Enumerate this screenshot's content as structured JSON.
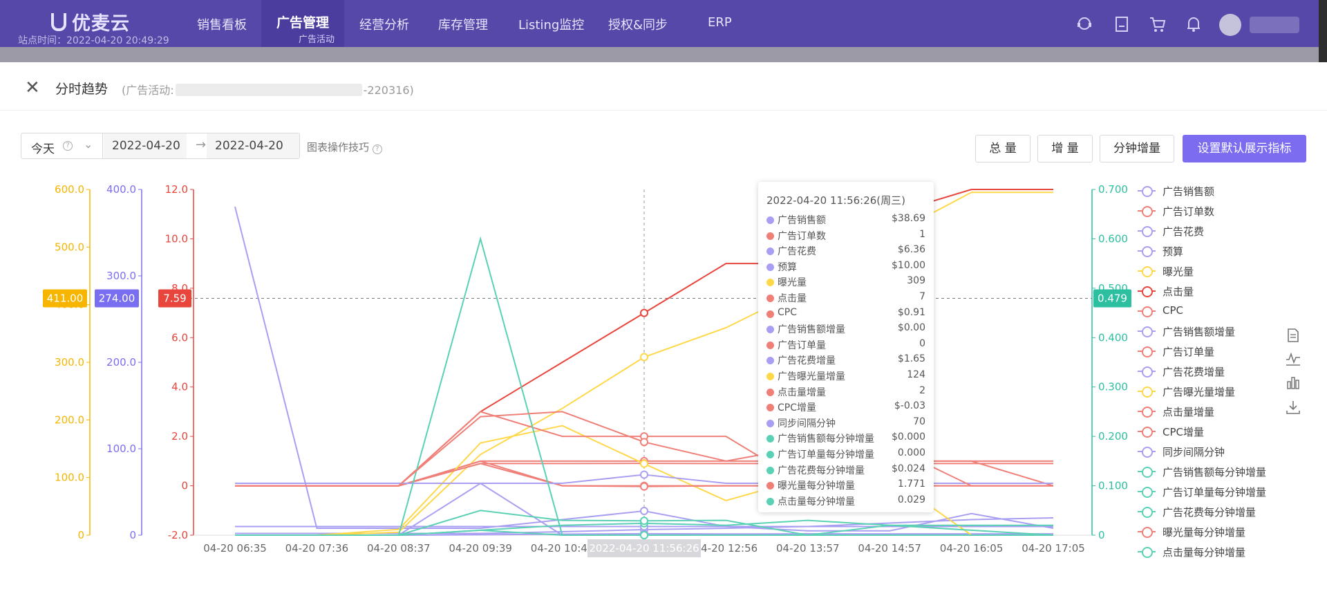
{
  "brand": "优麦云",
  "site_time": "站点时间：2022-04-20 20:49:29",
  "nav": [
    {
      "label": "销售看板"
    },
    {
      "label": "广告管理",
      "sub": "广告活动"
    },
    {
      "label": "经营分析"
    },
    {
      "label": "库存管理"
    },
    {
      "label": "Listing监控"
    },
    {
      "label": "授权&同步"
    },
    {
      "label": "ERP"
    }
  ],
  "top_icons": [
    "support-icon",
    "book-icon",
    "cart-icon",
    "bell-icon",
    "user-avatar-icon"
  ],
  "panel": {
    "title": "分时趋势",
    "subtitle_prefix": "(广告活动:",
    "subtitle_suffix": "-220316)"
  },
  "filters": {
    "range_label": "今天",
    "start_date": "2022-04-20",
    "end_date": "2022-04-20",
    "tips": "图表操作技巧"
  },
  "buttons": {
    "total": "总 量",
    "increment": "增 量",
    "minute_increment": "分钟增量",
    "set_default": "设置默认展示指标"
  },
  "colors": {
    "nav_bg": "#5548a8",
    "orange_axis": "#f7b500",
    "purple_axis": "#7a6ef0",
    "red_axis": "#e8453c",
    "teal_axis": "#2cbfa0"
  },
  "chart_data": {
    "type": "line",
    "x": [
      "04-20 06:35",
      "04-20 07:36",
      "04-20 08:37",
      "04-20 09:39",
      "04-20 10:46",
      "04-20 11:56:26",
      "04-20 12:56",
      "04-20 13:57",
      "04-20 14:57",
      "04-20 16:05",
      "04-20 17:05"
    ],
    "x_highlight": "2022-04-20 11:56:26",
    "axes": {
      "orange": {
        "min": 0,
        "max": 600,
        "ticks": [
          "0",
          "100.0",
          "200.0",
          "300.0",
          "400.0",
          "500.0",
          "600.0"
        ],
        "pointer": "411.00"
      },
      "purple": {
        "min": 0,
        "max": 400,
        "ticks": [
          "0",
          "100.0",
          "200.0",
          "300.0",
          "400.0"
        ],
        "pointer": "274.00"
      },
      "red": {
        "min": -2,
        "max": 12,
        "ticks": [
          "-2.0",
          "0",
          "2.0",
          "4.0",
          "6.0",
          "8.0",
          "10.0",
          "12.0"
        ],
        "pointer": "7.59"
      },
      "teal": {
        "min": 0,
        "max": 0.7,
        "ticks": [
          "0",
          "0.100",
          "0.200",
          "0.300",
          "0.400",
          "0.500",
          "0.600",
          "0.700"
        ],
        "pointer": "0.479"
      }
    },
    "series": [
      {
        "name": "广告销售额",
        "axis": "purple",
        "color": "#a89ff2",
        "values": [
          380,
          8,
          8,
          8,
          18,
          28,
          10,
          5,
          5,
          25,
          8
        ]
      },
      {
        "name": "广告订单数",
        "axis": "red",
        "color": "#f07f78",
        "values": [
          0,
          0,
          0,
          1,
          1,
          1,
          1,
          1,
          1,
          1,
          1
        ]
      },
      {
        "name": "广告花费",
        "axis": "purple",
        "color": "#a89ff2",
        "values": [
          2,
          2,
          2,
          2,
          4,
          6.36,
          8,
          10,
          14,
          18,
          20
        ]
      },
      {
        "name": "预算",
        "axis": "purple",
        "color": "#a89ff2",
        "values": [
          10,
          10,
          10,
          10,
          10,
          10,
          10,
          10,
          10,
          10,
          10
        ]
      },
      {
        "name": "曝光量",
        "axis": "orange",
        "color": "#ffd84a",
        "values": [
          0,
          0,
          5,
          140,
          220,
          309,
          360,
          430,
          520,
          595,
          595
        ]
      },
      {
        "name": "点击量",
        "axis": "red",
        "color": "#e8453c",
        "values": [
          0,
          0,
          0,
          3,
          5,
          7,
          9,
          9,
          11,
          12,
          12
        ]
      },
      {
        "name": "CPC",
        "axis": "red",
        "color": "#f07f78",
        "values": [
          0,
          0,
          0,
          0.9,
          0.9,
          0.91,
          0.9,
          0.9,
          0.9,
          0.9,
          0.9
        ]
      },
      {
        "name": "广告销售额增量",
        "axis": "purple",
        "color": "#a89ff2",
        "values": [
          0,
          0,
          0,
          60,
          0,
          0,
          0,
          0,
          0,
          0,
          0
        ]
      },
      {
        "name": "广告订单量",
        "axis": "red",
        "color": "#f07f78",
        "values": [
          0,
          0,
          0,
          1,
          0,
          0,
          0,
          0,
          0,
          0,
          0
        ]
      },
      {
        "name": "广告花费增量",
        "axis": "purple",
        "color": "#a89ff2",
        "values": [
          0,
          0,
          0,
          0.5,
          1.2,
          1.65,
          1.4,
          1.6,
          1.5,
          1.5,
          1.5
        ]
      },
      {
        "name": "广告曝光量增量",
        "axis": "orange",
        "color": "#ffd84a",
        "values": [
          0,
          0,
          10,
          160,
          190,
          124,
          60,
          100,
          100,
          0,
          0
        ]
      },
      {
        "name": "点击量增量",
        "axis": "red",
        "color": "#f07f78",
        "values": [
          0,
          0,
          0,
          3,
          2,
          2,
          2,
          0,
          1,
          1,
          0
        ]
      },
      {
        "name": "CPC增量",
        "axis": "red",
        "color": "#f07f78",
        "values": [
          0,
          0,
          0,
          0.9,
          0,
          -0.03,
          0,
          0,
          0,
          0,
          0
        ]
      },
      {
        "name": "同步间隔分钟",
        "axis": "purple",
        "color": "#a89ff2",
        "values": [
          60,
          60,
          60,
          60,
          60,
          70,
          60,
          60,
          60,
          60,
          60
        ]
      },
      {
        "name": "广告销售额每分钟增量",
        "axis": "teal",
        "color": "#5ad1b4",
        "values": [
          0,
          0,
          0,
          0.6,
          0,
          0,
          0,
          0,
          0,
          0,
          0
        ]
      },
      {
        "name": "广告订单量每分钟增量",
        "axis": "teal",
        "color": "#5ad1b4",
        "values": [
          0,
          0,
          0,
          0.01,
          0,
          0,
          0,
          0,
          0,
          0,
          0
        ]
      },
      {
        "name": "广告花费每分钟增量",
        "axis": "teal",
        "color": "#5ad1b4",
        "values": [
          0,
          0,
          0,
          0.01,
          0.02,
          0.024,
          0.02,
          0.03,
          0.02,
          0.02,
          0.02
        ]
      },
      {
        "name": "曝光量每分钟增量",
        "axis": "red",
        "color": "#f07f78",
        "values": [
          0,
          0,
          0,
          2.8,
          3,
          1.771,
          1,
          1.6,
          1.6,
          0,
          0
        ]
      },
      {
        "name": "点击量每分钟增量",
        "axis": "teal",
        "color": "#5ad1b4",
        "values": [
          0,
          0,
          0,
          0.05,
          0.03,
          0.029,
          0.03,
          0,
          0.02,
          0.01,
          0
        ]
      }
    ]
  },
  "tooltip": {
    "title": "2022-04-20 11:56:26(周三)",
    "rows": [
      {
        "label": "广告销售额",
        "value": "$38.69",
        "color": "#a89ff2"
      },
      {
        "label": "广告订单数",
        "value": "1",
        "color": "#f07f78"
      },
      {
        "label": "广告花费",
        "value": "$6.36",
        "color": "#a89ff2"
      },
      {
        "label": "预算",
        "value": "$10.00",
        "color": "#a89ff2"
      },
      {
        "label": "曝光量",
        "value": "309",
        "color": "#ffd84a"
      },
      {
        "label": "点击量",
        "value": "7",
        "color": "#f07f78"
      },
      {
        "label": "CPC",
        "value": "$0.91",
        "color": "#f07f78"
      },
      {
        "label": "广告销售额增量",
        "value": "$0.00",
        "color": "#a89ff2"
      },
      {
        "label": "广告订单量",
        "value": "0",
        "color": "#f07f78"
      },
      {
        "label": "广告花费增量",
        "value": "$1.65",
        "color": "#a89ff2"
      },
      {
        "label": "广告曝光量增量",
        "value": "124",
        "color": "#ffd84a"
      },
      {
        "label": "点击量增量",
        "value": "2",
        "color": "#f07f78"
      },
      {
        "label": "CPC增量",
        "value": "$-0.03",
        "color": "#f07f78"
      },
      {
        "label": "同步间隔分钟",
        "value": "70",
        "color": "#a89ff2"
      },
      {
        "label": "广告销售额每分钟增量",
        "value": "$0.000",
        "color": "#5ad1b4"
      },
      {
        "label": "广告订单量每分钟增量",
        "value": "0.000",
        "color": "#5ad1b4"
      },
      {
        "label": "广告花费每分钟增量",
        "value": "$0.024",
        "color": "#5ad1b4"
      },
      {
        "label": "曝光量每分钟增量",
        "value": "1.771",
        "color": "#f07f78"
      },
      {
        "label": "点击量每分钟增量",
        "value": "0.029",
        "color": "#5ad1b4"
      }
    ]
  },
  "side_tools": [
    "data-view-icon",
    "line-chart-icon",
    "bar-chart-icon",
    "download-icon"
  ]
}
